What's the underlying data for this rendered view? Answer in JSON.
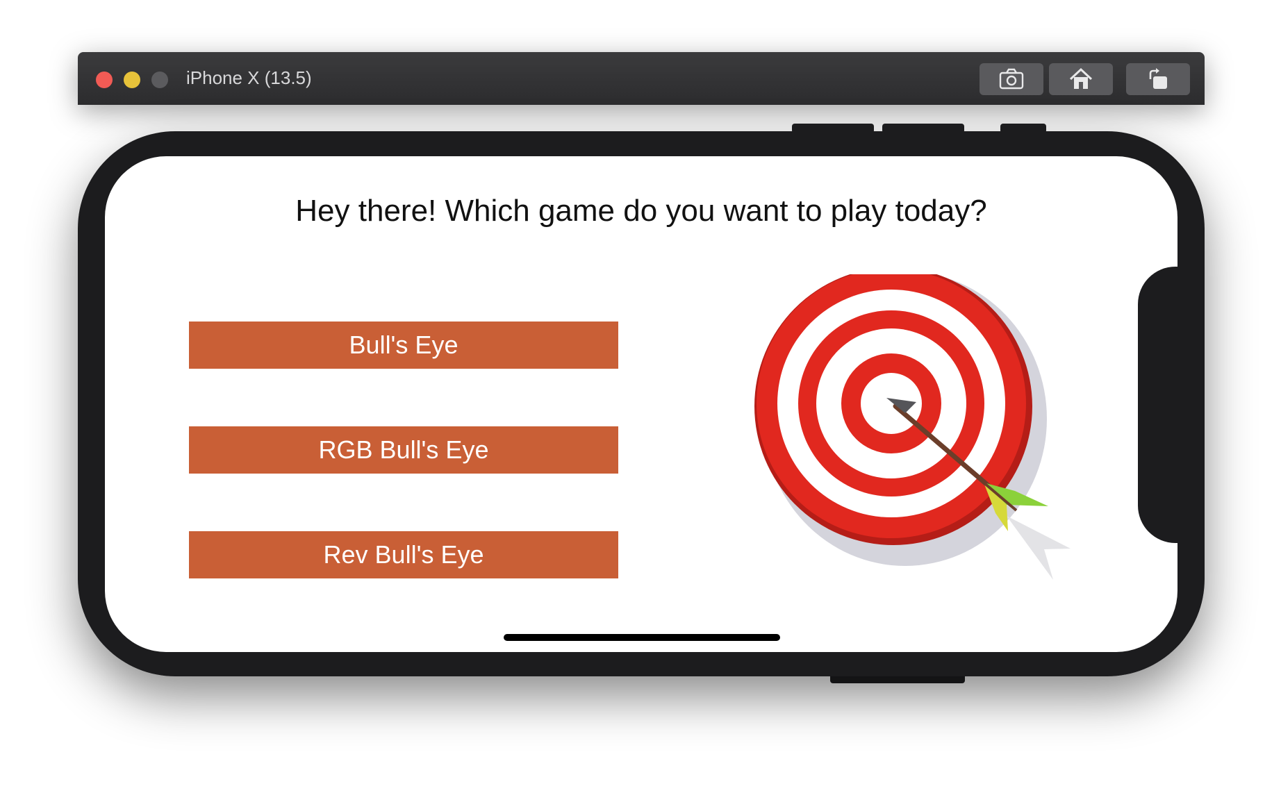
{
  "window": {
    "title": "iPhone X (13.5)",
    "toolbar": [
      {
        "icon": "screenshot-icon"
      },
      {
        "icon": "home-icon"
      },
      {
        "icon": "rotate-icon"
      }
    ]
  },
  "screen": {
    "prompt": "Hey there! Which game do you want to play today?",
    "buttons": [
      {
        "label": "Bull's Eye"
      },
      {
        "label": "RGB Bull's Eye"
      },
      {
        "label": "Rev Bull's Eye"
      }
    ],
    "image": {
      "icon": "dartboard-target-with-arrow"
    }
  },
  "colors": {
    "button_bg": "#c95f36",
    "button_text": "#ffffff",
    "target_red": "#e1281f",
    "target_dark_red": "#b51d17"
  }
}
